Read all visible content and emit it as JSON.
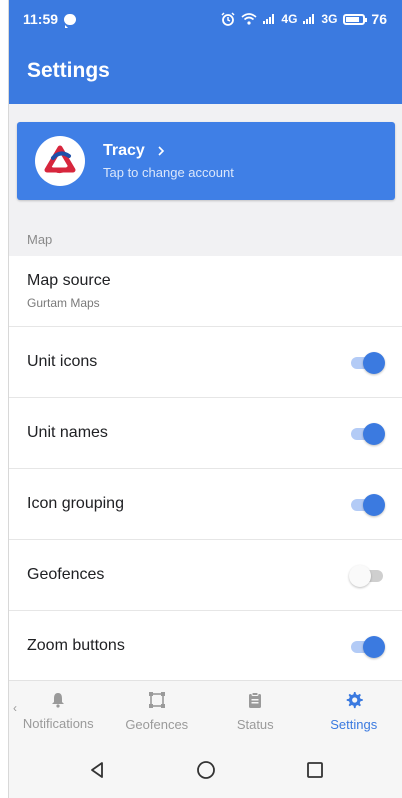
{
  "status_bar": {
    "time": "11:59",
    "battery": "76",
    "net_4g": "4G",
    "net_3g": "3G"
  },
  "app_bar": {
    "title": "Settings"
  },
  "account": {
    "name": "Tracy",
    "subtitle": "Tap to change account"
  },
  "section": {
    "label": "Map"
  },
  "map_source": {
    "title": "Map source",
    "value": "Gurtam Maps"
  },
  "toggles": [
    {
      "label": "Unit icons",
      "on": true
    },
    {
      "label": "Unit names",
      "on": true
    },
    {
      "label": "Icon grouping",
      "on": true
    },
    {
      "label": "Geofences",
      "on": false
    },
    {
      "label": "Zoom buttons",
      "on": true
    }
  ],
  "bottom_nav": [
    {
      "label": "Notifications",
      "icon": "bell-icon",
      "active": false
    },
    {
      "label": "Geofences",
      "icon": "geofence-icon",
      "active": false
    },
    {
      "label": "Status",
      "icon": "clipboard-icon",
      "active": false
    },
    {
      "label": "Settings",
      "icon": "gear-icon",
      "active": true
    }
  ],
  "colors": {
    "primary": "#3b7ae0",
    "toggle_track_on": "#b3cbf6",
    "toggle_track_off": "#cfcfcf",
    "background": "#f1f1f3"
  }
}
